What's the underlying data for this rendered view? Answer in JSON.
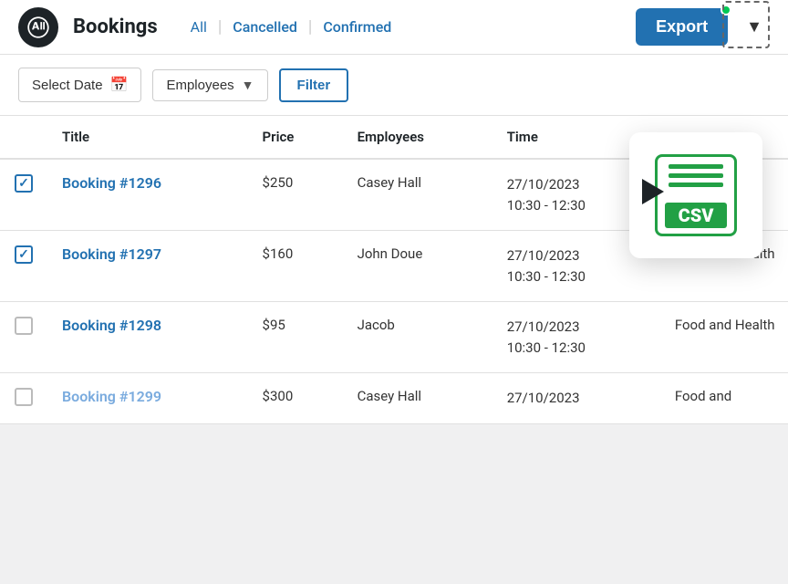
{
  "header": {
    "app_name": "Bookings",
    "nav": {
      "all": "All",
      "cancelled": "Cancelled",
      "confirmed": "Confirmed"
    },
    "export_label": "Export",
    "dropdown_arrow": "▼"
  },
  "toolbar": {
    "select_date": "Select Date",
    "employees_dropdown": "Employees",
    "filter_btn": "Filter"
  },
  "table": {
    "headers": [
      "",
      "Title",
      "Price",
      "Employees",
      "Time",
      ""
    ],
    "rows": [
      {
        "checked": true,
        "title": "Booking #1296",
        "price": "$250",
        "employee": "Casey Hall",
        "date": "27/10/2023",
        "time_range": "10:30 - 12:30",
        "category": "",
        "dimmed": false
      },
      {
        "checked": true,
        "title": "Booking #1297",
        "price": "$160",
        "employee": "John Doue",
        "date": "27/10/2023",
        "time_range": "10:30 - 12:30",
        "category": "Food and Health",
        "dimmed": false
      },
      {
        "checked": false,
        "title": "Booking #1298",
        "price": "$95",
        "employee": "Jacob",
        "date": "27/10/2023",
        "time_range": "10:30 - 12:30",
        "category": "Food and Health",
        "dimmed": false
      },
      {
        "checked": false,
        "title": "Booking #1299",
        "price": "$300",
        "employee": "Casey Hall",
        "date": "27/10/2023",
        "time_range": "",
        "category": "Food and",
        "dimmed": true
      }
    ]
  },
  "csv_popup": {
    "label": "CSV"
  },
  "colors": {
    "blue": "#2271b1",
    "green": "#22a045",
    "text_dark": "#1d2327"
  }
}
